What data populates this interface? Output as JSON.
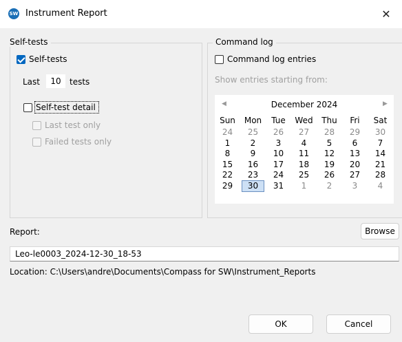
{
  "window": {
    "title": "Instrument Report",
    "app_icon_text": "SW",
    "close_glyph": "✕"
  },
  "selftests": {
    "group_title": "Self-tests",
    "checkbox_label": "Self-tests",
    "checked": true,
    "last_label": "Last",
    "last_value": "10",
    "tests_label": "tests",
    "detail_label": "Self-test detail",
    "last_only_label": "Last test only",
    "failed_only_label": "Failed tests only"
  },
  "command_log": {
    "group_title": "Command log",
    "checkbox_label": "Command log entries",
    "checked": false,
    "show_from_label": "Show entries starting from:"
  },
  "calendar": {
    "month_label": "December 2024",
    "prev_glyph": "◀",
    "next_glyph": "▶",
    "weekdays": [
      "Sun",
      "Mon",
      "Tue",
      "Wed",
      "Thu",
      "Fri",
      "Sat"
    ],
    "weeks": [
      [
        "24",
        "25",
        "26",
        "27",
        "28",
        "29",
        "30"
      ],
      [
        "1",
        "2",
        "3",
        "4",
        "5",
        "6",
        "7"
      ],
      [
        "8",
        "9",
        "10",
        "11",
        "12",
        "13",
        "14"
      ],
      [
        "15",
        "16",
        "17",
        "18",
        "19",
        "20",
        "21"
      ],
      [
        "22",
        "23",
        "24",
        "25",
        "26",
        "27",
        "28"
      ],
      [
        "29",
        "30",
        "31",
        "1",
        "2",
        "3",
        "4"
      ]
    ],
    "selected": "30"
  },
  "report": {
    "label": "Report:",
    "browse_label": "Browse",
    "filename": "Leo-le0003_2024-12-30_18-53",
    "location": "Location: C:\\Users\\andre\\Documents\\Compass for SW\\Instrument_Reports"
  },
  "buttons": {
    "ok_label": "OK",
    "cancel_label": "Cancel"
  }
}
